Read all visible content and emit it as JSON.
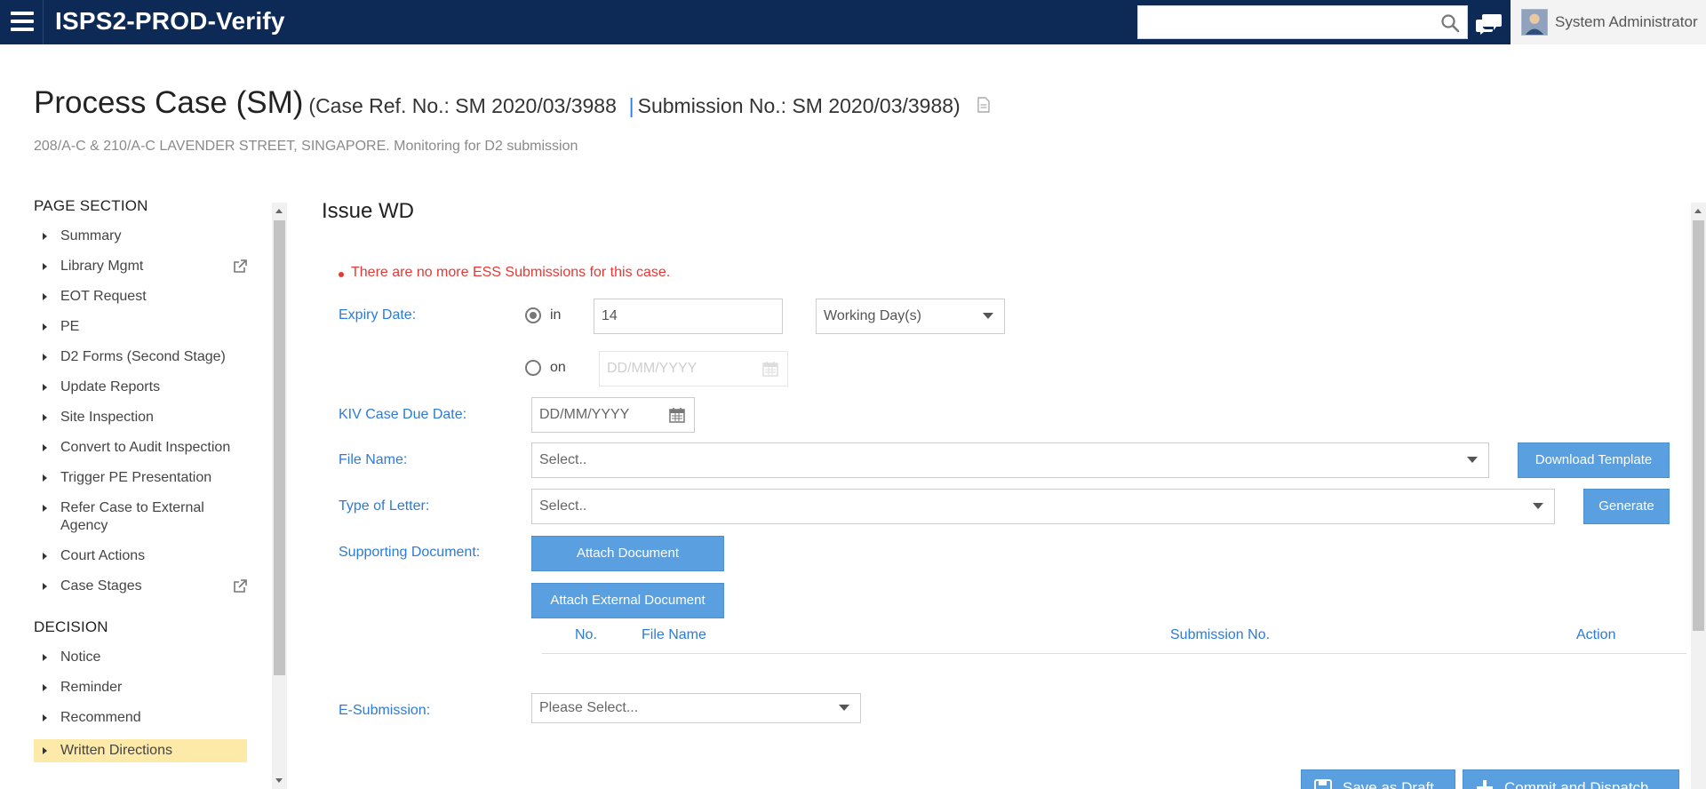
{
  "app": {
    "title": "ISPS2-PROD-Verify"
  },
  "header": {
    "search_value": "",
    "user_name": "System Administrator"
  },
  "page": {
    "title": "Process Case (SM)",
    "case_ref_label": "(Case Ref. No.: SM 2020/03/3988",
    "separator": "|",
    "submission_label": "Submission No.: SM 2020/03/3988)",
    "subtitle": "208/A-C & 210/A-C LAVENDER STREET, SINGAPORE. Monitoring for D2 submission"
  },
  "sidebar": {
    "page_section_heading": "PAGE SECTION",
    "page_section_items": [
      {
        "label": "Summary"
      },
      {
        "label": "Library Mgmt",
        "external": true
      },
      {
        "label": "EOT Request"
      },
      {
        "label": "PE"
      },
      {
        "label": "D2 Forms (Second Stage)"
      },
      {
        "label": "Update Reports"
      },
      {
        "label": "Site Inspection"
      },
      {
        "label": "Convert to Audit Inspection"
      },
      {
        "label": "Trigger PE Presentation"
      },
      {
        "label": "Refer Case to External Agency"
      },
      {
        "label": "Court Actions"
      },
      {
        "label": "Case Stages",
        "external": true
      }
    ],
    "decision_heading": "DECISION",
    "decision_items": [
      {
        "label": "Notice"
      },
      {
        "label": "Reminder"
      },
      {
        "label": "Recommend"
      },
      {
        "label": "Written Directions",
        "active": true
      }
    ]
  },
  "form": {
    "section_title": "Issue WD",
    "error": "There are no more ESS Submissions for this case.",
    "expiry_label": "Expiry Date:",
    "radio_in_label": "in",
    "radio_in_checked": true,
    "expiry_days_value": "14",
    "expiry_unit_value": "Working Day(s)",
    "radio_on_label": "on",
    "expiry_date_placeholder": "DD/MM/YYYY",
    "kiv_label": "KIV Case Due Date:",
    "kiv_placeholder": "DD/MM/YYYY",
    "file_name_label": "File Name:",
    "file_name_placeholder": "Select..",
    "download_template_label": "Download Template",
    "type_letter_label": "Type of Letter:",
    "type_letter_placeholder": "Select..",
    "generate_label": "Generate",
    "supporting_doc_label": "Supporting Document:",
    "attach_doc_label": "Attach Document",
    "attach_ext_doc_label": "Attach External Document",
    "table_columns": [
      "No.",
      "File Name",
      "Submission No.",
      "Action"
    ],
    "esubmission_label": "E-Submission:",
    "esubmission_placeholder": "Please Select..."
  },
  "footer": {
    "save_draft_label": "Save as Draft",
    "commit_label": "Commit and Dispatch"
  },
  "colors": {
    "topbar": "#0c2a55",
    "link_blue": "#2d7bd6",
    "button_blue": "#5a9fe0",
    "error_red": "#e53935",
    "active_item": "#fde9a8"
  }
}
